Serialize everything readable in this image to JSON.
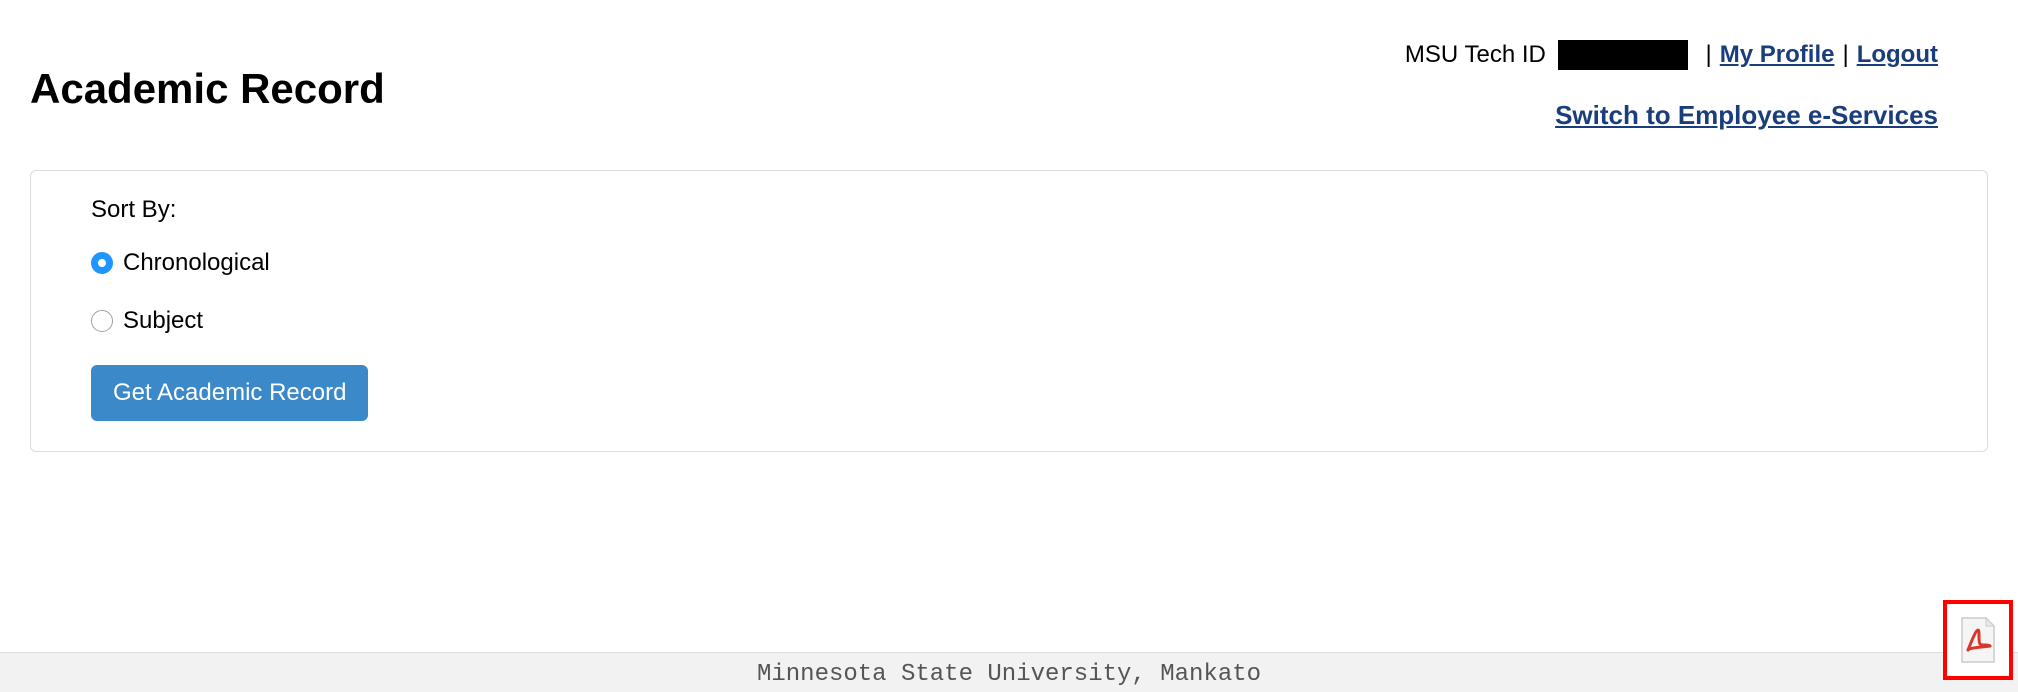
{
  "header": {
    "page_title": "Academic Record",
    "tech_id_label": "MSU Tech ID ",
    "my_profile_label": "My Profile",
    "logout_label": "Logout",
    "switch_link_label": "Switch to Employee e-Services"
  },
  "form": {
    "sort_by_label": "Sort By:",
    "option_chronological": "Chronological",
    "option_subject": "Subject",
    "button_label": "Get Academic Record"
  },
  "footer": {
    "text": "Minnesota State University, Mankato"
  }
}
